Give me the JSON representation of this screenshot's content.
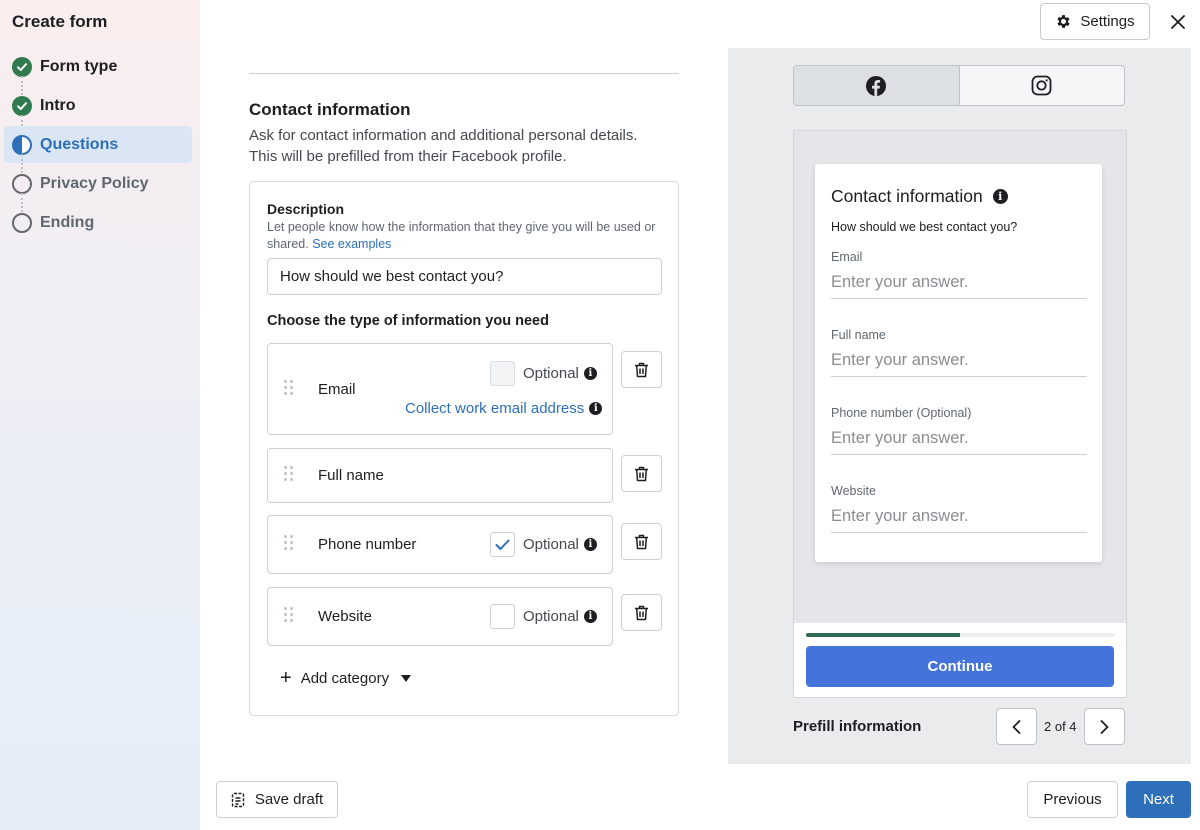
{
  "sidebar": {
    "title": "Create form",
    "steps": [
      {
        "label": "Form type",
        "state": "done"
      },
      {
        "label": "Intro",
        "state": "done"
      },
      {
        "label": "Questions",
        "state": "active"
      },
      {
        "label": "Privacy Policy",
        "state": "pending"
      },
      {
        "label": "Ending",
        "state": "pending"
      }
    ]
  },
  "header": {
    "settings_label": "Settings",
    "settings_icon": "gear-icon",
    "close_icon": "close-icon"
  },
  "section": {
    "title": "Contact information",
    "description_line1": "Ask for contact information and additional personal details.",
    "description_line2": "This will be prefilled from their Facebook profile."
  },
  "description": {
    "label": "Description",
    "help": "Let people know how the information that they give you will be used or shared.",
    "help_link": "See examples",
    "value": "How should we best contact you?"
  },
  "fields": {
    "choose_label": "Choose the type of information you need",
    "items": [
      {
        "name": "Email",
        "optional_label": "Optional",
        "optional_checked": false,
        "optional_disabled": true,
        "extra_link": "Collect work email address"
      },
      {
        "name": "Full name"
      },
      {
        "name": "Phone number",
        "optional_label": "Optional",
        "optional_checked": true
      },
      {
        "name": "Website",
        "optional_label": "Optional",
        "optional_checked": false
      }
    ],
    "add_category_label": "Add category"
  },
  "footer": {
    "save_draft_label": "Save draft",
    "previous_label": "Previous",
    "next_label": "Next"
  },
  "preview": {
    "platforms": [
      "facebook",
      "instagram"
    ],
    "selected_platform": "facebook",
    "card_title": "Contact information",
    "card_subtitle": "How should we best contact you?",
    "fields": [
      {
        "label": "Email",
        "placeholder": "Enter your answer."
      },
      {
        "label": "Full name",
        "placeholder": "Enter your answer."
      },
      {
        "label": "Phone number (Optional)",
        "placeholder": "Enter your answer."
      },
      {
        "label": "Website",
        "placeholder": "Enter your answer."
      }
    ],
    "progress": 0.5,
    "continue_label": "Continue",
    "prefill_label": "Prefill information",
    "pager_text": "2 of 4"
  },
  "colors": {
    "accent": "#2d6fb8",
    "done": "#2f7a4f",
    "continue": "#4474d9",
    "progress": "#2f6b52"
  }
}
